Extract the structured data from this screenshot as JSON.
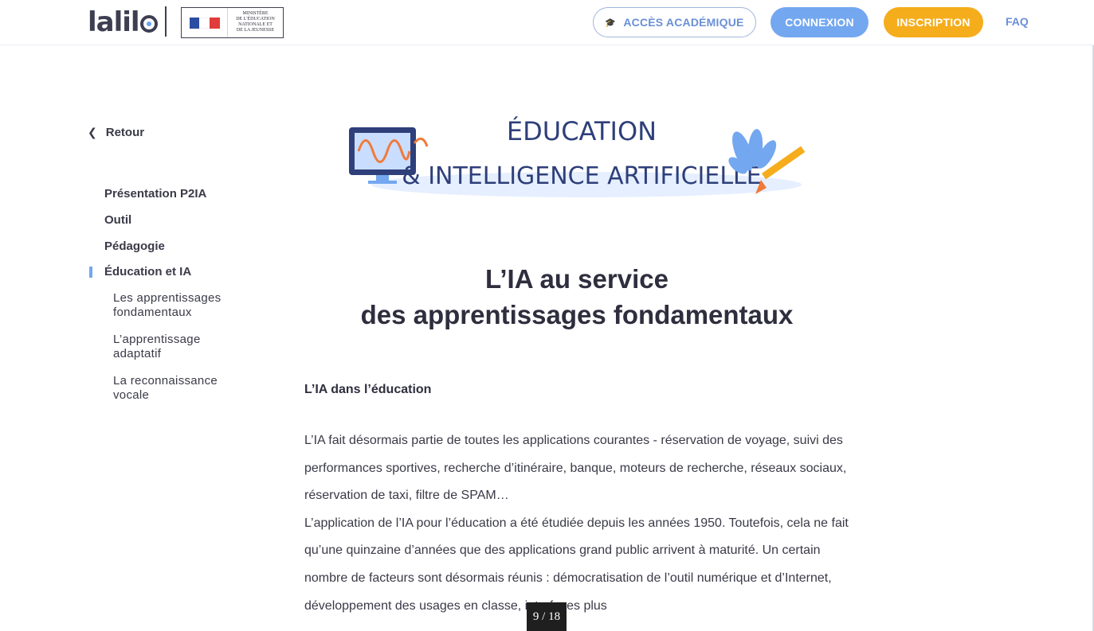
{
  "header": {
    "logo_text": "lalil",
    "ministry_lines": [
      "Ministère",
      "de l'éducation",
      "nationale et",
      "de la jeunesse"
    ],
    "flag_colors": [
      "#2b4ca3",
      "#ffffff",
      "#e23b3b"
    ],
    "buttons": {
      "academic": "ACCÈS ACADÉMIQUE",
      "academic_icon": "graduation-cap-icon",
      "login": "CONNEXION",
      "signup": "INSCRIPTION",
      "faq": "FAQ"
    },
    "colors": {
      "academic_text": "#6a8fd6",
      "login_bg": "#73a7f0",
      "signup_bg": "#f5ad1b"
    }
  },
  "sidebar": {
    "back_label": "Retour",
    "items": [
      {
        "label": "Présentation P2IA"
      },
      {
        "label": "Outil"
      },
      {
        "label": "Pédagogie"
      },
      {
        "label": "Éducation et IA",
        "active": true
      }
    ],
    "sub_items": [
      {
        "label": "Les apprentissages fondamentaux"
      },
      {
        "label": "L’apprentissage adaptatif"
      },
      {
        "label": "La reconnaissance vocale"
      }
    ]
  },
  "banner": {
    "line1": "ÉDUCATION",
    "line2": "& INTELLIGENCE ARTIFICIELLE"
  },
  "main": {
    "title_line1": "L’IA au service",
    "title_line2": "des apprentissages fondamentaux",
    "section_title": "L’IA dans l’éducation",
    "paragraph1": "L’IA fait désormais partie de toutes les applications courantes - réservation de voyage, suivi des performances sportives, recherche d’itinéraire, banque, moteurs de recherche, réseaux sociaux, réservation de taxi, filtre de SPAM…",
    "paragraph2": "L’application de l’IA pour l’éducation a été étudiée depuis les années 1950. Toutefois, cela ne fait qu’une quinzaine d’années que des applications grand public arrivent à maturité. Un certain nombre de facteurs sont désormais réunis : démocratisation de l’outil numérique et d’Internet, développement des usages en classe, interfaces plus"
  },
  "page_indicator": "9 / 18"
}
